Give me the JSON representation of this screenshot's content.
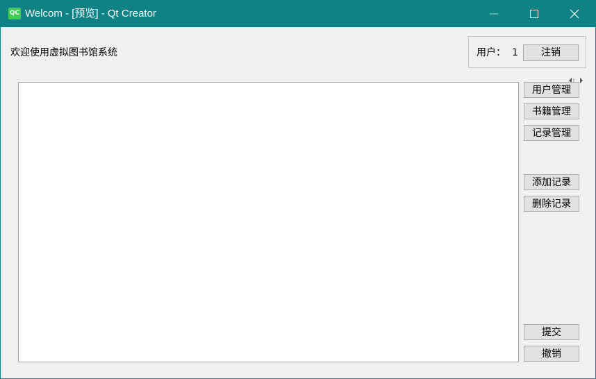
{
  "window": {
    "title": "Welcom - [预览] - Qt Creator",
    "app_icon_text": "QC",
    "accent_color": "#0e8284"
  },
  "header": {
    "welcome_text": "欢迎使用虚拟图书馆系统",
    "user_label": "用户：",
    "user_id": "1",
    "logout_label": "注销"
  },
  "side_buttons": {
    "user_manage": "用户管理",
    "book_manage": "书籍管理",
    "record_manage": "记录管理",
    "add_record": "添加记录",
    "delete_record": "删除记录",
    "submit": "提交",
    "cancel": "撤销"
  }
}
